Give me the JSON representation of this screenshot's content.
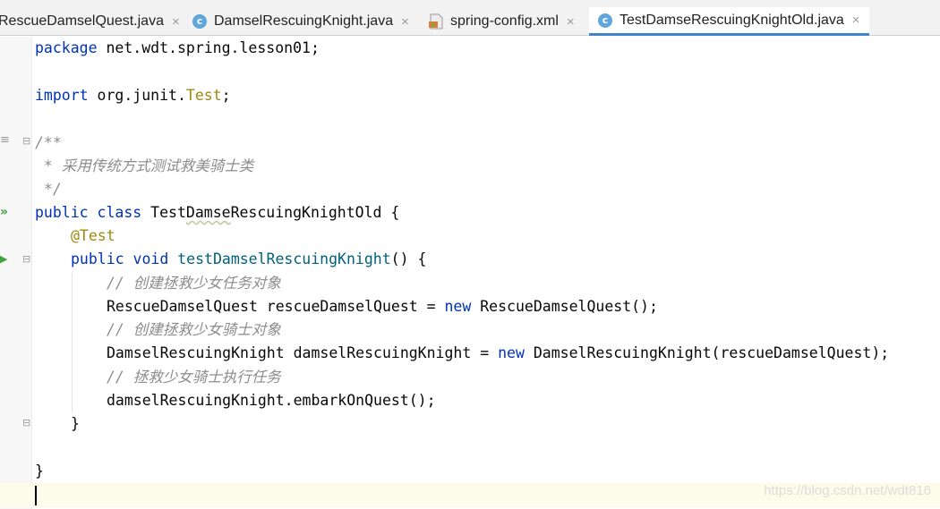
{
  "tabs": [
    {
      "label": "RescueDamselQuest.java",
      "close": "×",
      "icon": "none",
      "active": false
    },
    {
      "label": "DamselRescuingKnight.java",
      "close": "×",
      "icon": "java-class-icon",
      "icon_text": "c",
      "active": false
    },
    {
      "label": "spring-config.xml",
      "close": "×",
      "icon": "xml-file-icon",
      "active": false
    },
    {
      "label": "TestDamseRescuingKnightOld.java",
      "close": "×",
      "icon": "java-class-icon",
      "icon_text": "c",
      "active": true
    }
  ],
  "code": {
    "package_kw": "package",
    "package_name": " net.wdt.spring.lesson01;",
    "import_kw": "import",
    "import_path": " org.junit.",
    "import_cls": "Test",
    "import_end": ";",
    "doc_open": "/**",
    "doc_line": " * 采用传统方式测试救美骑士类",
    "doc_close": " */",
    "class_kw1": "public",
    "class_kw2": " class",
    "class_name_a": " Test",
    "class_name_b": "Damse",
    "class_name_c": "RescuingKnightOld {",
    "annotation": "@Test",
    "method_kw1": "public",
    "method_kw2": " void",
    "method_name": " testDamselRescuingKnight",
    "method_end": "() {",
    "comment1": "// 创建拯救少女任务对象",
    "stmt1_a": "RescueDamselQuest rescueDamselQuest = ",
    "stmt1_new": "new",
    "stmt1_b": " RescueDamselQuest();",
    "comment2": "// 创建拯救少女骑士对象",
    "stmt2_a": "DamselRescuingKnight damselRescuingKnight = ",
    "stmt2_new": "new",
    "stmt2_b": " DamselRescuingKnight(rescueDamselQuest);",
    "comment3": "// 拯救少女骑士执行任务",
    "stmt3": "damselRescuingKnight.embarkOnQuest();",
    "method_close": "}",
    "class_close": "}"
  },
  "watermark": "https://blog.csdn.net/wdt816",
  "colors": {
    "keyword": "#0033b3",
    "annotation": "#9e880d",
    "comment": "#8c8c8c",
    "method": "#00627a",
    "active_tab_underline": "#4083c9",
    "current_line": "#fdfbe9"
  }
}
